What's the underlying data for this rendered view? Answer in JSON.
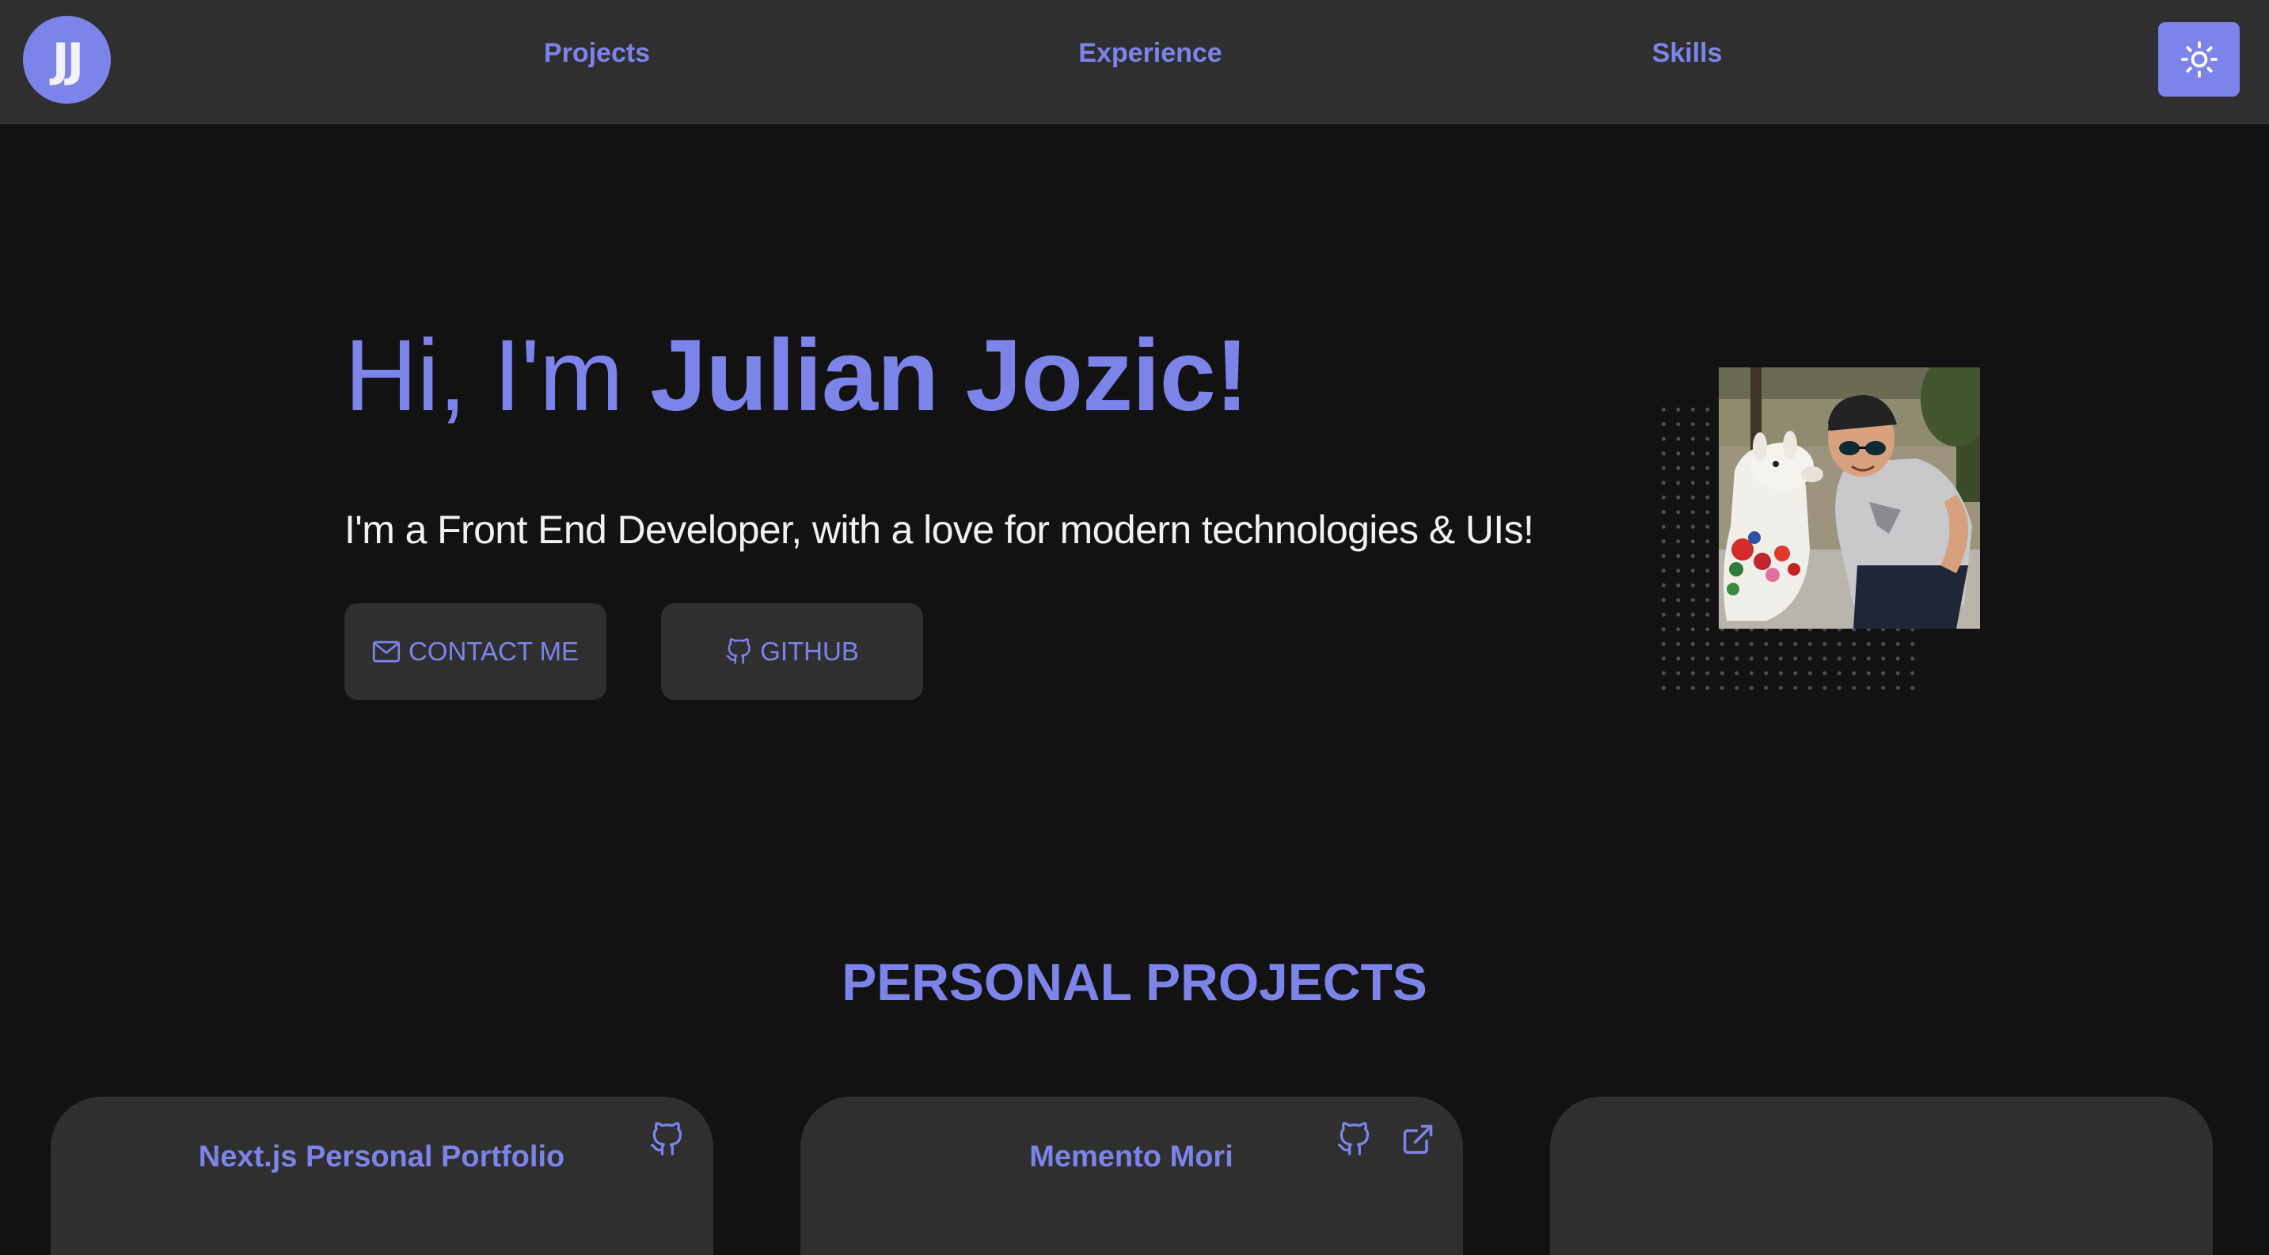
{
  "navbar": {
    "logo_text": "JJ",
    "links": [
      {
        "label": "Projects"
      },
      {
        "label": "Experience"
      },
      {
        "label": "Skills"
      }
    ],
    "theme_toggle_icon": "sun-icon"
  },
  "hero": {
    "greeting": "Hi, I'm ",
    "name": "Julian Jozic!",
    "subtitle": "I'm a Front End Developer, with a love for modern technologies & UIs!",
    "buttons": {
      "contact": {
        "label": "CONTACT ME",
        "icon": "mail-icon"
      },
      "github": {
        "label": "GITHUB",
        "icon": "github-icon"
      }
    }
  },
  "projects": {
    "title": "PERSONAL PROJECTS",
    "cards": [
      {
        "title": "Next.js Personal Portfolio",
        "icons": [
          "github-icon"
        ]
      },
      {
        "title": "Memento Mori",
        "icons": [
          "github-icon",
          "external-link-icon"
        ]
      },
      {
        "title": "",
        "icons": []
      }
    ]
  },
  "colors": {
    "accent": "#7c84ea",
    "background": "#121213",
    "surface": "#2f2f30",
    "text": "#f2f2f4"
  }
}
